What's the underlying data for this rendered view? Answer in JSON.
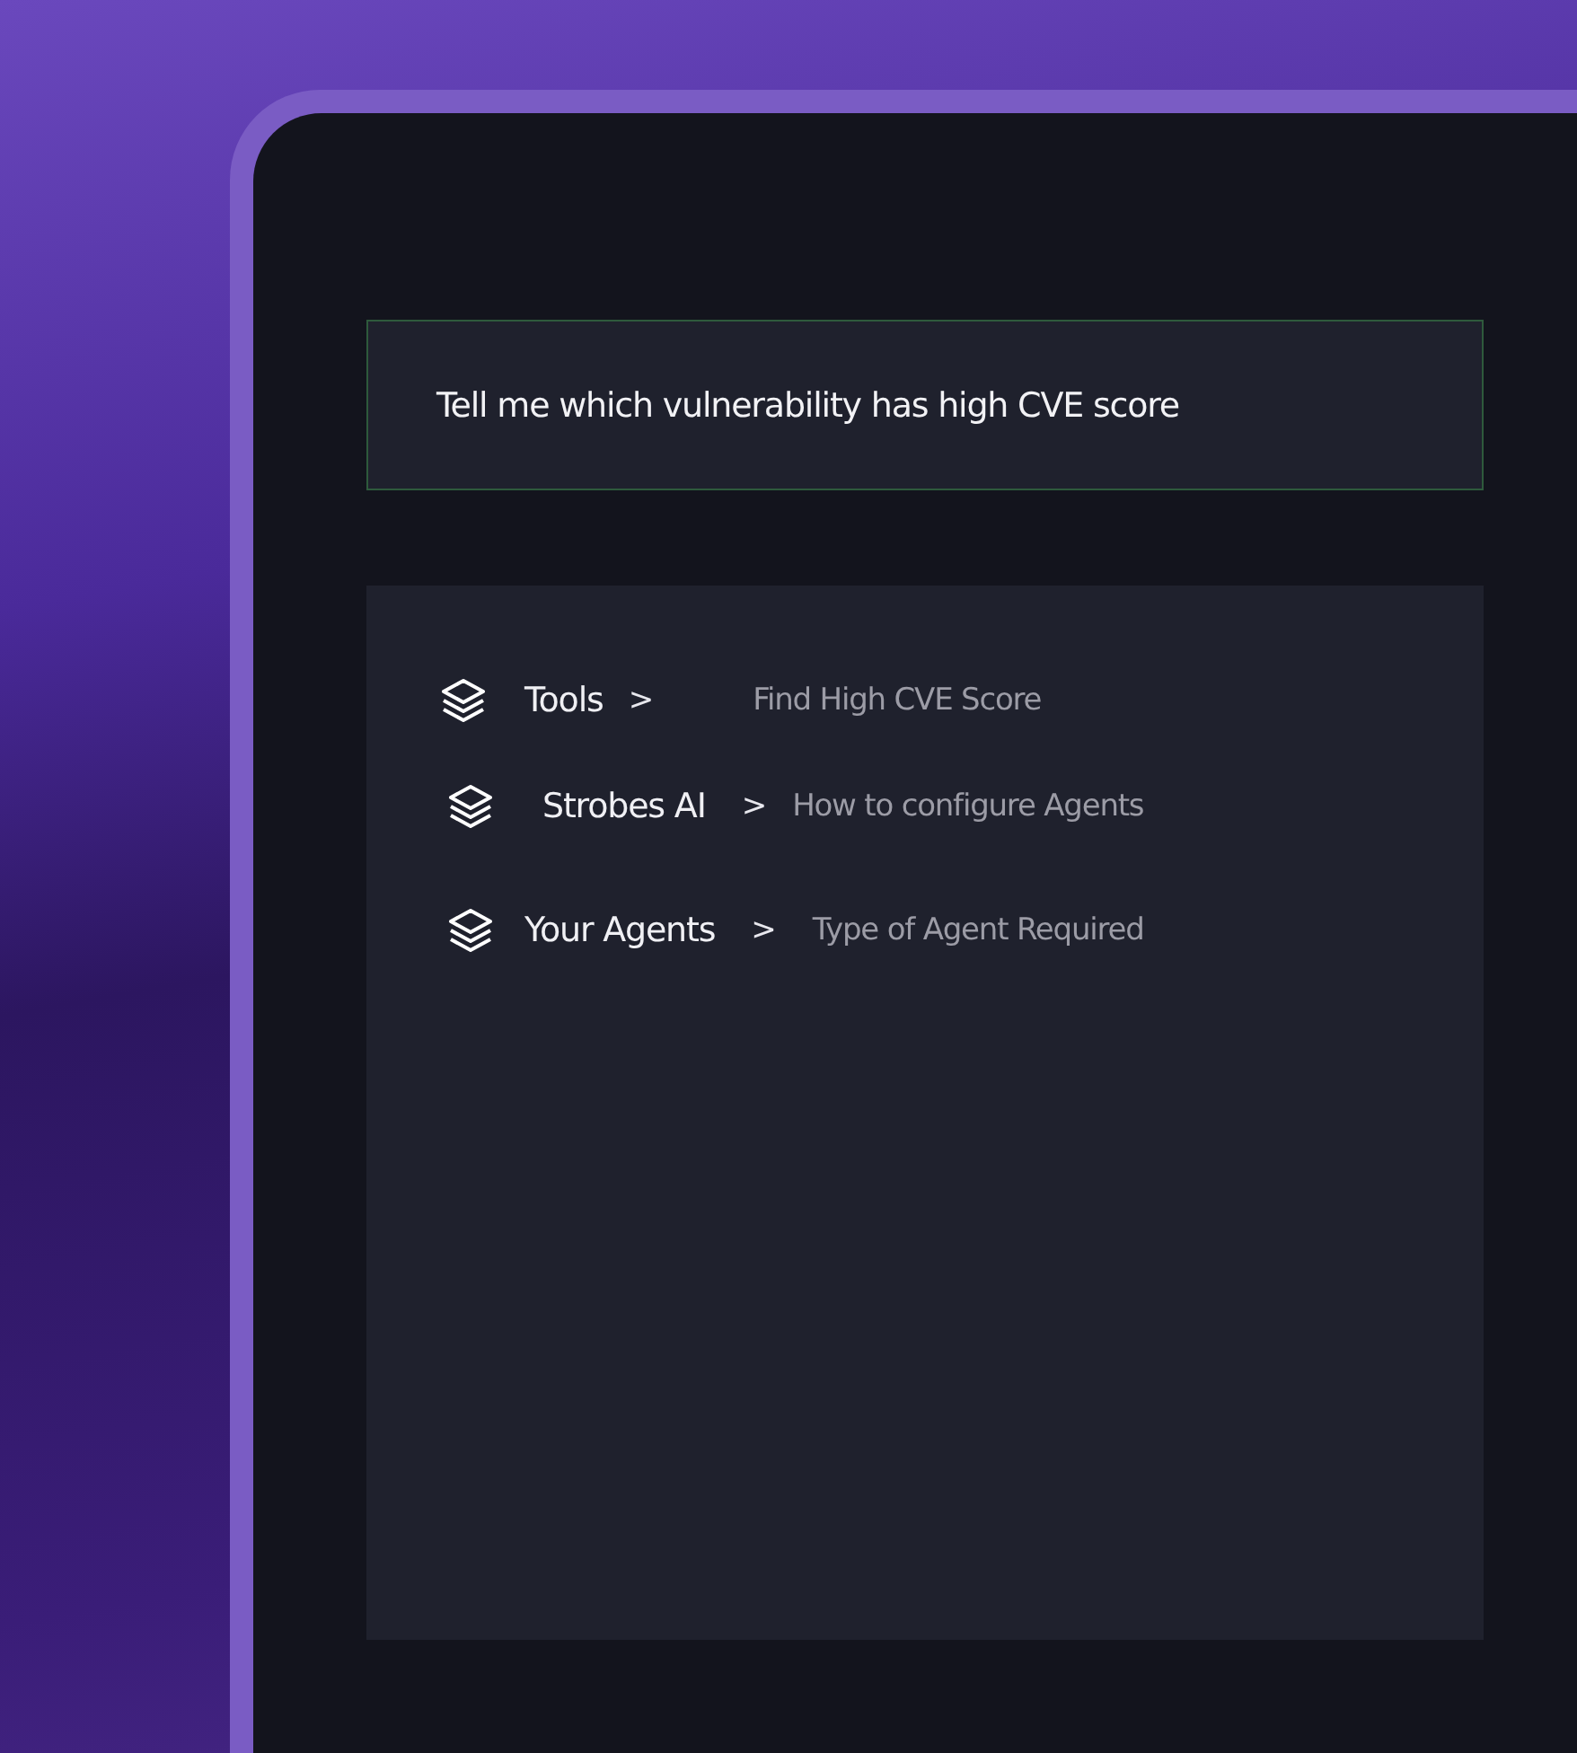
{
  "query": "Tell me which vulnerability has high CVE score",
  "suggestions": [
    {
      "category": "Tools",
      "separator": ">",
      "prompt": "Find High CVE Score"
    },
    {
      "category": "Strobes AI",
      "separator": ">",
      "prompt": "How to configure Agents"
    },
    {
      "category": "Your Agents",
      "separator": ">",
      "prompt": "Type of Agent Required"
    }
  ]
}
